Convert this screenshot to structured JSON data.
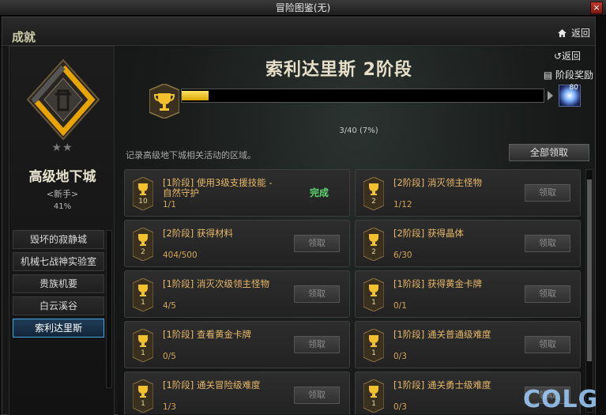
{
  "window_title": "冒险图鉴(无)",
  "close_icon": "close-icon",
  "header": {
    "title": "成就",
    "back_label": "返回"
  },
  "left_panel": {
    "stars": "★★",
    "dungeon_name": "高级地下城",
    "level": "<新手>",
    "percent": "41%",
    "nav_items": [
      "毁坏的寂静城",
      "机械七战神实验室",
      "贵族机要",
      "白云溪谷",
      "索利达里斯"
    ],
    "active_index": 4
  },
  "main": {
    "stage_title": "索利达里斯 2阶段",
    "return_label": "↺返回",
    "reward_label": "阶段奖励",
    "reward_count": "80",
    "progress": {
      "current": 3,
      "total": 40,
      "percent": 7,
      "text": "3/40 (7%)"
    },
    "description": "记录高级地下城相关活动的区域。",
    "claim_all_label": "全部领取"
  },
  "achievements": [
    {
      "badge": "10",
      "name": "[1阶段] 使用3级支援技能 - 自然守护",
      "count": "1/1",
      "status": "完成"
    },
    {
      "badge": "2",
      "name": "[2阶段] 消灭领主怪物",
      "count": "1/12",
      "status": "领取"
    },
    {
      "badge": "2",
      "name": "[2阶段] 获得材料",
      "count": "404/500",
      "status": "领取"
    },
    {
      "badge": "2",
      "name": "[2阶段] 获得晶体",
      "count": "6/30",
      "status": "领取"
    },
    {
      "badge": "1",
      "name": "[1阶段] 消灭次级领主怪物",
      "count": "4/5",
      "status": "领取"
    },
    {
      "badge": "1",
      "name": "[1阶段] 获得黄金卡牌",
      "count": "0/1",
      "status": "领取"
    },
    {
      "badge": "1",
      "name": "[1阶段] 查看黄金卡牌",
      "count": "0/5",
      "status": "领取"
    },
    {
      "badge": "1",
      "name": "[1阶段] 通关普通级难度",
      "count": "0/3",
      "status": "领取"
    },
    {
      "badge": "1",
      "name": "[1阶段] 通关冒险级难度",
      "count": "1/3",
      "status": "领取"
    },
    {
      "badge": "1",
      "name": "[1阶段] 通关勇士级难度",
      "count": "0/3",
      "status": "领取"
    }
  ],
  "watermark": "COLG",
  "colors": {
    "accent_gold": "#e8b968",
    "done_green": "#5bd66e",
    "active_blue": "#47a6e8",
    "bar_yellow": "#ffe266"
  }
}
